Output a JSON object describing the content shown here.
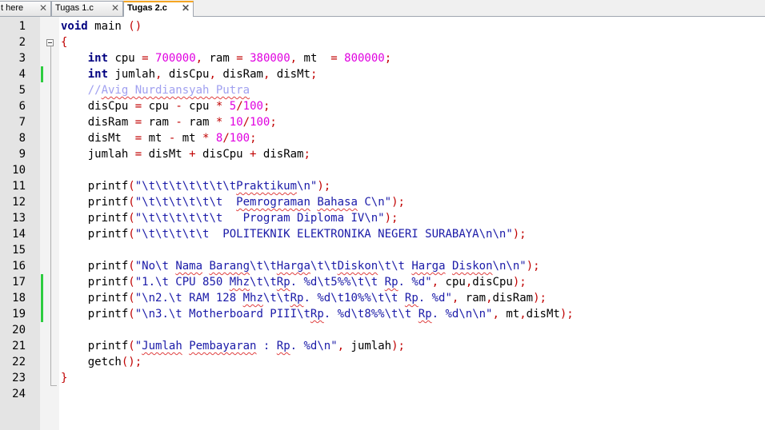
{
  "tabs": [
    {
      "label": "t here",
      "active": false
    },
    {
      "label": "Tugas 1.c",
      "active": false
    },
    {
      "label": "Tugas 2.c",
      "active": true
    }
  ],
  "close_glyph": "✕",
  "line_numbers": [
    "1",
    "2",
    "3",
    "4",
    "5",
    "6",
    "7",
    "8",
    "9",
    "10",
    "11",
    "12",
    "13",
    "14",
    "15",
    "16",
    "17",
    "18",
    "19",
    "20",
    "21",
    "22",
    "23",
    "24"
  ],
  "changed_lines": [
    4,
    17,
    18,
    19
  ],
  "code": [
    [
      [
        "kw",
        "void"
      ],
      [
        "t",
        " main "
      ],
      [
        "op",
        "()"
      ]
    ],
    [
      [
        "op",
        "{"
      ]
    ],
    [
      [
        "t",
        "    "
      ],
      [
        "kw",
        "int"
      ],
      [
        "t",
        " cpu "
      ],
      [
        "op",
        "="
      ],
      [
        "t",
        " "
      ],
      [
        "num",
        "700000"
      ],
      [
        "op",
        ","
      ],
      [
        "t",
        " ram "
      ],
      [
        "op",
        "="
      ],
      [
        "t",
        " "
      ],
      [
        "num",
        "380000"
      ],
      [
        "op",
        ","
      ],
      [
        "t",
        " mt  "
      ],
      [
        "op",
        "="
      ],
      [
        "t",
        " "
      ],
      [
        "num",
        "800000"
      ],
      [
        "op",
        ";"
      ]
    ],
    [
      [
        "t",
        "    "
      ],
      [
        "kw",
        "int"
      ],
      [
        "t",
        " jumlah"
      ],
      [
        "op",
        ","
      ],
      [
        "t",
        " disCpu"
      ],
      [
        "op",
        ","
      ],
      [
        "t",
        " disRam"
      ],
      [
        "op",
        ","
      ],
      [
        "t",
        " disMt"
      ],
      [
        "op",
        ";"
      ]
    ],
    [
      [
        "t",
        "    "
      ],
      [
        "cmt",
        "//"
      ],
      [
        "cmtsp",
        "Avig Nurdiansyah Putra"
      ]
    ],
    [
      [
        "t",
        "    disCpu "
      ],
      [
        "op",
        "="
      ],
      [
        "t",
        " cpu "
      ],
      [
        "op",
        "-"
      ],
      [
        "t",
        " cpu "
      ],
      [
        "op",
        "*"
      ],
      [
        "t",
        " "
      ],
      [
        "num",
        "5"
      ],
      [
        "op",
        "/"
      ],
      [
        "num",
        "100"
      ],
      [
        "op",
        ";"
      ]
    ],
    [
      [
        "t",
        "    disRam "
      ],
      [
        "op",
        "="
      ],
      [
        "t",
        " ram "
      ],
      [
        "op",
        "-"
      ],
      [
        "t",
        " ram "
      ],
      [
        "op",
        "*"
      ],
      [
        "t",
        " "
      ],
      [
        "num",
        "10"
      ],
      [
        "op",
        "/"
      ],
      [
        "num",
        "100"
      ],
      [
        "op",
        ";"
      ]
    ],
    [
      [
        "t",
        "    disMt  "
      ],
      [
        "op",
        "="
      ],
      [
        "t",
        " mt "
      ],
      [
        "op",
        "-"
      ],
      [
        "t",
        " mt "
      ],
      [
        "op",
        "*"
      ],
      [
        "t",
        " "
      ],
      [
        "num",
        "8"
      ],
      [
        "op",
        "/"
      ],
      [
        "num",
        "100"
      ],
      [
        "op",
        ";"
      ]
    ],
    [
      [
        "t",
        "    jumlah "
      ],
      [
        "op",
        "="
      ],
      [
        "t",
        " disMt "
      ],
      [
        "op",
        "+"
      ],
      [
        "t",
        " disCpu "
      ],
      [
        "op",
        "+"
      ],
      [
        "t",
        " disRam"
      ],
      [
        "op",
        ";"
      ]
    ],
    [],
    [
      [
        "t",
        "    printf"
      ],
      [
        "op",
        "("
      ],
      [
        "str",
        "\"\\t\\t\\t\\t\\t\\t\\t"
      ],
      [
        "strsp",
        "Praktikum"
      ],
      [
        "str",
        "\\n\""
      ],
      [
        "op",
        ");"
      ]
    ],
    [
      [
        "t",
        "    printf"
      ],
      [
        "op",
        "("
      ],
      [
        "str",
        "\"\\t\\t\\t\\t\\t\\t  "
      ],
      [
        "strsp",
        "Pemrograman"
      ],
      [
        "str",
        " "
      ],
      [
        "strsp",
        "Bahasa"
      ],
      [
        "str",
        " C\\n\""
      ],
      [
        "op",
        ");"
      ]
    ],
    [
      [
        "t",
        "    printf"
      ],
      [
        "op",
        "("
      ],
      [
        "str",
        "\"\\t\\t\\t\\t\\t\\t   Program Diploma IV\\n\""
      ],
      [
        "op",
        ");"
      ]
    ],
    [
      [
        "t",
        "    printf"
      ],
      [
        "op",
        "("
      ],
      [
        "str",
        "\"\\t\\t\\t\\t\\t  POLITEKNIK ELEKTRONIKA NEGERI SURABAYA\\n\\n\""
      ],
      [
        "op",
        ");"
      ]
    ],
    [],
    [
      [
        "t",
        "    printf"
      ],
      [
        "op",
        "("
      ],
      [
        "str",
        "\"No\\t "
      ],
      [
        "strsp",
        "Nama"
      ],
      [
        "str",
        " "
      ],
      [
        "strsp",
        "Barang"
      ],
      [
        "str",
        "\\t\\t"
      ],
      [
        "strsp",
        "Harga"
      ],
      [
        "str",
        "\\t\\t"
      ],
      [
        "strsp",
        "Diskon"
      ],
      [
        "str",
        "\\t\\t "
      ],
      [
        "strsp",
        "Harga"
      ],
      [
        "str",
        " "
      ],
      [
        "strsp",
        "Diskon"
      ],
      [
        "str",
        "\\n\\n\""
      ],
      [
        "op",
        ");"
      ]
    ],
    [
      [
        "t",
        "    printf"
      ],
      [
        "op",
        "("
      ],
      [
        "str",
        "\"1.\\t CPU 850 "
      ],
      [
        "strsp",
        "Mhz"
      ],
      [
        "str",
        "\\t\\t"
      ],
      [
        "strsp",
        "Rp"
      ],
      [
        "str",
        ". %d\\t5%%\\t\\t "
      ],
      [
        "strsp",
        "Rp"
      ],
      [
        "str",
        ". %d\""
      ],
      [
        "op",
        ","
      ],
      [
        "t",
        " cpu"
      ],
      [
        "op",
        ","
      ],
      [
        "t",
        "disCpu"
      ],
      [
        "op",
        ");"
      ]
    ],
    [
      [
        "t",
        "    printf"
      ],
      [
        "op",
        "("
      ],
      [
        "str",
        "\"\\n2.\\t RAM 128 "
      ],
      [
        "strsp",
        "Mhz"
      ],
      [
        "str",
        "\\t\\t"
      ],
      [
        "strsp",
        "Rp"
      ],
      [
        "str",
        ". %d\\t10%%\\t\\t "
      ],
      [
        "strsp",
        "Rp"
      ],
      [
        "str",
        ". %d\""
      ],
      [
        "op",
        ","
      ],
      [
        "t",
        " ram"
      ],
      [
        "op",
        ","
      ],
      [
        "t",
        "disRam"
      ],
      [
        "op",
        ");"
      ]
    ],
    [
      [
        "t",
        "    printf"
      ],
      [
        "op",
        "("
      ],
      [
        "str",
        "\"\\n3.\\t Motherboard PIII\\t"
      ],
      [
        "strsp",
        "Rp"
      ],
      [
        "str",
        ". %d\\t8%%\\t\\t "
      ],
      [
        "strsp",
        "Rp"
      ],
      [
        "str",
        ". %d\\n\\n\""
      ],
      [
        "op",
        ","
      ],
      [
        "t",
        " mt"
      ],
      [
        "op",
        ","
      ],
      [
        "t",
        "disMt"
      ],
      [
        "op",
        ");"
      ]
    ],
    [],
    [
      [
        "t",
        "    printf"
      ],
      [
        "op",
        "("
      ],
      [
        "str",
        "\""
      ],
      [
        "strsp",
        "Jumlah"
      ],
      [
        "str",
        " "
      ],
      [
        "strsp",
        "Pembayaran"
      ],
      [
        "str",
        " : "
      ],
      [
        "strsp",
        "Rp"
      ],
      [
        "str",
        ". %d\\n\""
      ],
      [
        "op",
        ","
      ],
      [
        "t",
        " jumlah"
      ],
      [
        "op",
        ");"
      ]
    ],
    [
      [
        "t",
        "    getch"
      ],
      [
        "op",
        "();"
      ]
    ],
    [
      [
        "op",
        "}"
      ]
    ],
    []
  ],
  "colors": {
    "keyword": "#000080",
    "number": "#e000e0",
    "operator": "#c00000",
    "string": "#1a1aa8",
    "comment": "#a0a0f0",
    "changed_marker": "#2ecc40",
    "active_tab_accent": "#f5a623"
  }
}
